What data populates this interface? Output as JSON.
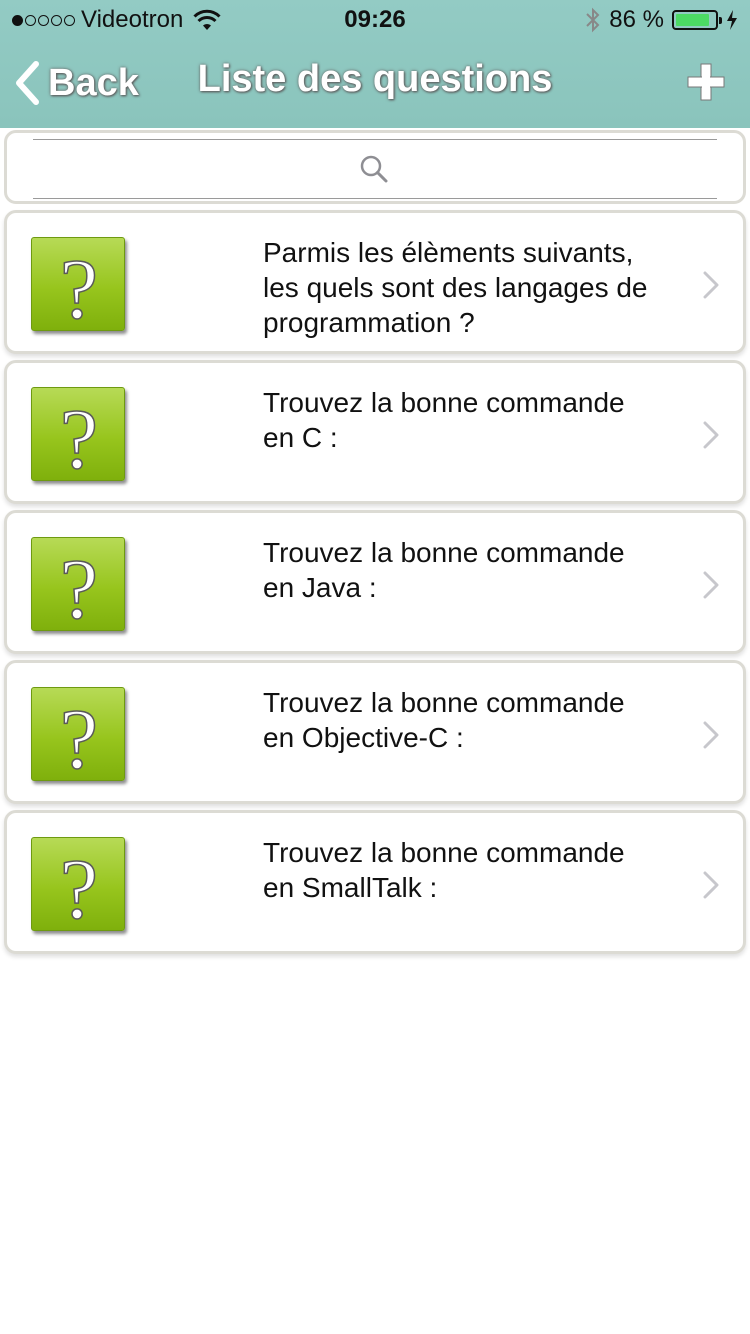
{
  "status_bar": {
    "carrier": "Videotron",
    "time": "09:26",
    "battery_text": "86 %",
    "battery_level": 0.86
  },
  "navbar": {
    "back_label": "Back",
    "title": "Liste des questions",
    "add_icon": "plus-icon"
  },
  "search": {
    "placeholder": "",
    "icon": "search-icon"
  },
  "questions": [
    {
      "text": "Parmis les élèments suivants, les quels sont des langages de programmation ?"
    },
    {
      "text": "Trouvez la bonne commande en C :"
    },
    {
      "text": "Trouvez la bonne commande en Java :"
    },
    {
      "text": "Trouvez la bonne commande en Objective-C :"
    },
    {
      "text": "Trouvez la bonne commande en SmallTalk :"
    }
  ],
  "colors": {
    "header": "#8ec7c0",
    "icon_green": "#97c51d",
    "card_border": "#dcdbd4"
  }
}
